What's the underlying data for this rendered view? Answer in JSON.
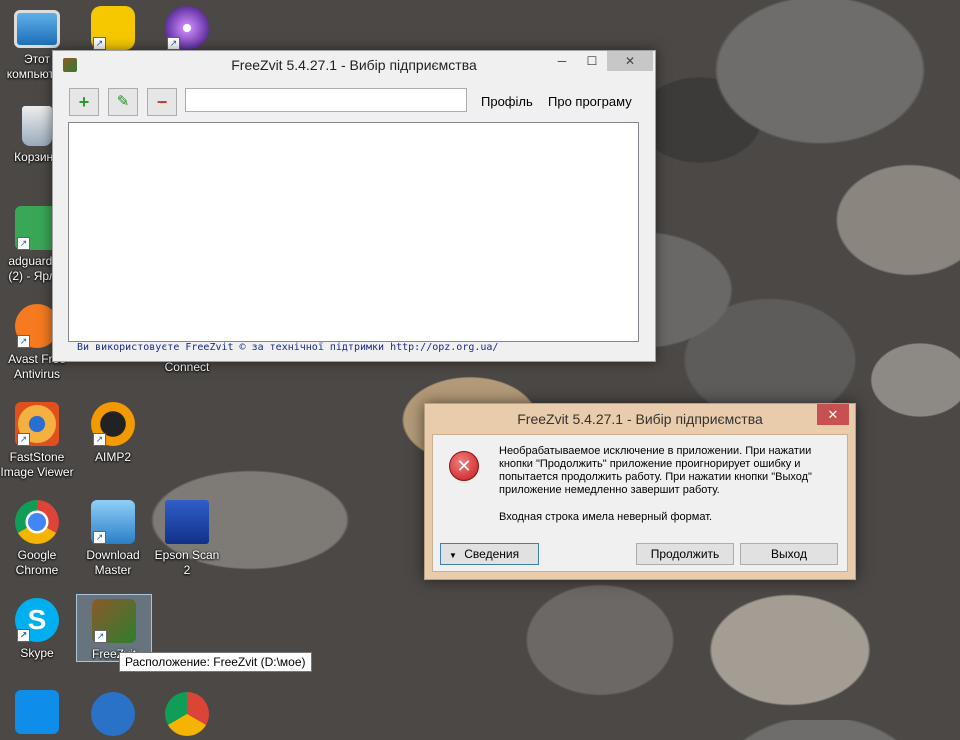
{
  "desktop": {
    "icons": [
      {
        "label": "Этот компьютер"
      },
      {
        "label": "Корзина"
      },
      {
        "label": "adguardI... (2) - Ярл..."
      },
      {
        "label": "Avast Free Antivirus"
      },
      {
        "label": "FastStone Image Viewer"
      },
      {
        "label": "AIMP2"
      },
      {
        "label": "Google Chrome"
      },
      {
        "label": "Download Master"
      },
      {
        "label": "Epson Scan 2"
      },
      {
        "label": "Skype"
      },
      {
        "label": "FreeZvit"
      },
      {
        "label": "Connect"
      }
    ],
    "tooltip": "Расположение: FreeZvit (D:\\мое)"
  },
  "main_window": {
    "title": "FreeZvit 5.4.27.1 - Вибір підприємства",
    "search_value": "",
    "menu": [
      "Профіль",
      "Про програму"
    ],
    "status": "Ви використовуєте FreeZvit © за технічної підтримки http://opz.org.ua/"
  },
  "error_dialog": {
    "title": "FreeZvit 5.4.27.1 - Вибір підприємства",
    "message": "Необрабатываемое исключение в приложении. При нажатии кнопки \"Продолжить\" приложение проигнорирует ошибку и попытается продолжить работу. При нажатии кнопки \"Выход\" приложение немедленно завершит работу.",
    "detail": "Входная строка имела неверный формат.",
    "details_button": "Сведения",
    "continue_button": "Продолжить",
    "exit_button": "Выход"
  },
  "colors": {
    "error_accent": "#c75050",
    "dialog_frame": "#e8ccab",
    "status_text": "#1a2a8a"
  }
}
